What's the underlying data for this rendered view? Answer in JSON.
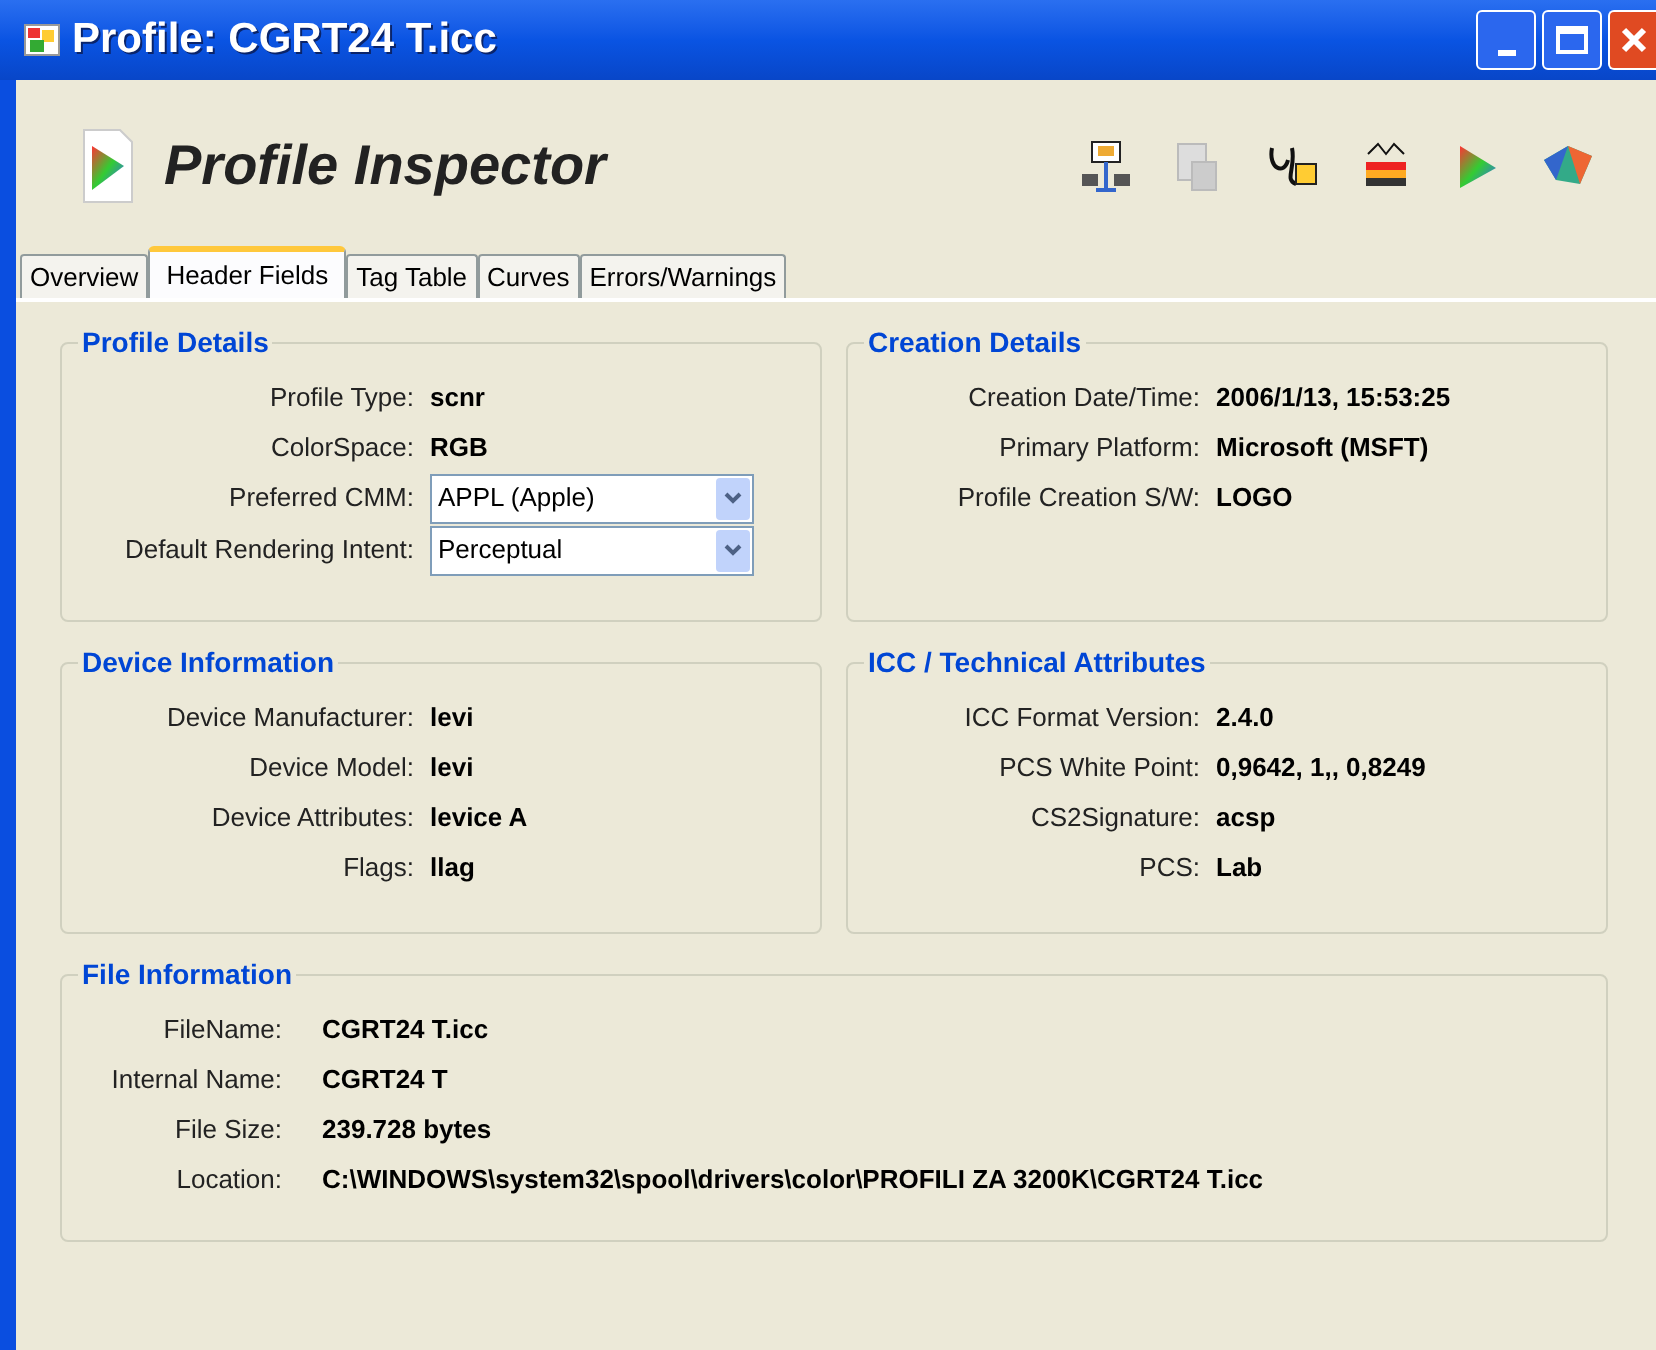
{
  "window": {
    "title": "Profile: CGRT24 T.icc"
  },
  "app_title": "Profile Inspector",
  "tabs": [
    {
      "label": "Overview",
      "selected": false
    },
    {
      "label": "Header Fields",
      "selected": true
    },
    {
      "label": "Tag Table",
      "selected": false
    },
    {
      "label": "Curves",
      "selected": false
    },
    {
      "label": "Errors/Warnings",
      "selected": false
    }
  ],
  "groups": [
    {
      "title": "Profile Details",
      "fields": [
        {
          "kind": "text",
          "label": "Profile Type:",
          "value": "scnr"
        },
        {
          "kind": "text",
          "label": "ColorSpace:",
          "value": "RGB"
        },
        {
          "kind": "dropdown",
          "label": "Preferred CMM:",
          "value": "APPL (Apple)"
        },
        {
          "kind": "dropdown",
          "label": "Default Rendering Intent:",
          "value": "Perceptual"
        }
      ]
    },
    {
      "title": "Creation Details",
      "fields": [
        {
          "kind": "text",
          "label": "Creation Date/Time:",
          "value": "2006/1/13, 15:53:25"
        },
        {
          "kind": "text",
          "label": "Primary Platform:",
          "value": "Microsoft (MSFT)"
        },
        {
          "kind": "text",
          "label": "Profile Creation S/W:",
          "value": "LOGO"
        }
      ]
    },
    {
      "title": "Device Information",
      "fields": [
        {
          "kind": "text",
          "label": "Device Manufacturer:",
          "value": "levi"
        },
        {
          "kind": "text",
          "label": "Device Model:",
          "value": "levi"
        },
        {
          "kind": "text",
          "label": "Device Attributes:",
          "value": "levice A"
        },
        {
          "kind": "text",
          "label": "Flags:",
          "value": "llag"
        }
      ]
    },
    {
      "title": "ICC / Technical Attributes",
      "fields": [
        {
          "kind": "text",
          "label": "ICC Format Version:",
          "value": "2.4.0"
        },
        {
          "kind": "text",
          "label": "PCS White Point:",
          "value": "0,9642, 1,, 0,8249"
        },
        {
          "kind": "text",
          "label": "CS2Signature:",
          "value": "acsp"
        },
        {
          "kind": "text",
          "label": "PCS:",
          "value": "Lab"
        }
      ]
    },
    {
      "title": "File Information",
      "fields": [
        {
          "kind": "text",
          "label": "FileName:",
          "value": "CGRT24 T.icc"
        },
        {
          "kind": "text",
          "label": "Internal Name:",
          "value": "CGRT24 T"
        },
        {
          "kind": "text",
          "label": "File Size:",
          "value": "239.728 bytes"
        },
        {
          "kind": "text",
          "label": "Location:",
          "value": "C:\\WINDOWS\\system32\\spool\\drivers\\color\\PROFILI ZA 3200K\\CGRT24 T.icc"
        }
      ]
    }
  ]
}
